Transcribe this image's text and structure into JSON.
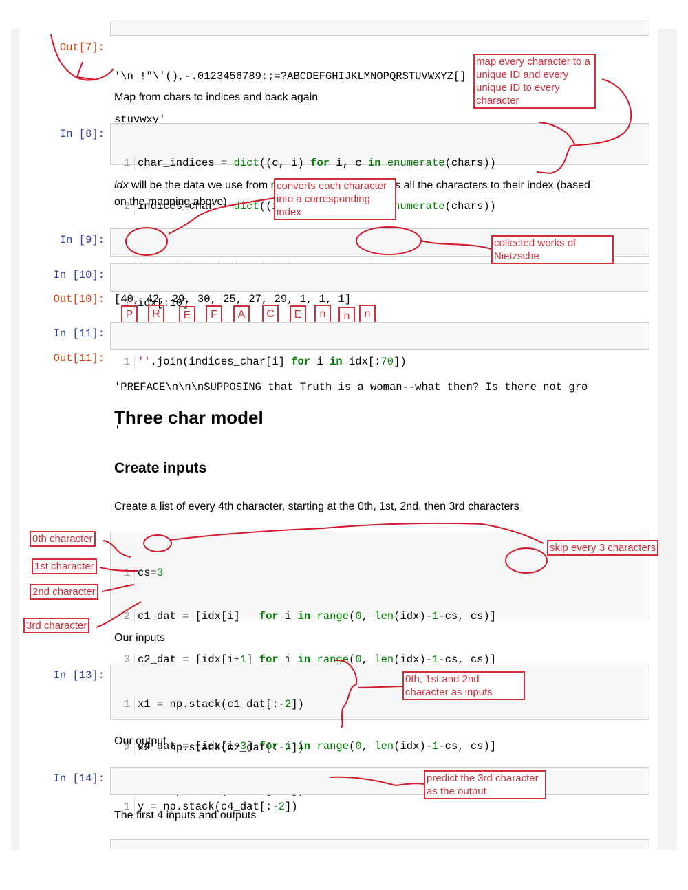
{
  "cells": {
    "out7": {
      "prompt": "Out[7]:",
      "line1": "'\\n !\"\\'(),-.0123456789:;=?ABCDEFGHIJKLMNOPQRSTUVWXYZ[] abcdefghijklmnopqr",
      "line2": "stuvwxy'"
    },
    "md_map": "Map from chars to indices and back again",
    "in8": {
      "prompt": "In [8]:",
      "l1_var": "char_indices",
      "l2_var": "indices_char"
    },
    "md_idx": {
      "em": "idx",
      "rest1": " will be the data we use from now on - it simply converts all the characters to their index (based",
      "rest2": "on the mapping above)"
    },
    "in9": {
      "prompt": "In [9]:"
    },
    "in10": {
      "prompt": "In [10]:",
      "code": "idx[:10]"
    },
    "out10": {
      "prompt": "Out[10]:",
      "value": "[40, 42, 29, 30, 25, 27, 29, 1, 1, 1]"
    },
    "in11": {
      "prompt": "In [11]:"
    },
    "out11": {
      "prompt": "Out[11]:",
      "line1": "'PREFACE\\n\\n\\nSUPPOSING that Truth is a woman--what then? Is there not gro",
      "line2": "'"
    },
    "h_model": "Three char model",
    "h_inputs": "Create inputs",
    "md_every4": "Create a list of every 4th character, starting at the 0th, 1st, 2nd, then 3rd characters",
    "in12": {
      "prompt": ""
    },
    "md_inputs": "Our inputs",
    "in13": {
      "prompt": "In [13]:"
    },
    "md_output": "Our output",
    "in14": {
      "prompt": "In [14]:"
    },
    "md_first4": "The first 4 inputs and outputs"
  },
  "annotations": {
    "map_every": "map every character to a unique ID and every unique ID to every character",
    "converts": "converts each character into a corresponding index",
    "nietzsche": "collected works of Nietzsche",
    "letters": [
      "P",
      "R",
      "E",
      "F",
      "A",
      "C",
      "E",
      "n",
      "n",
      "n"
    ],
    "skip": "skip every 3 characters",
    "c0": "0th character",
    "c1": "1st character",
    "c2": "2nd character",
    "c3": "3rd character",
    "inputs_note": "0th, 1st and 2nd character as inputs",
    "predict": "predict the 3rd character as the output"
  },
  "colors": {
    "annotation": "#d32f3a",
    "keyword": "#008000",
    "in_prompt": "#303f9f",
    "out_prompt": "#d84315"
  }
}
